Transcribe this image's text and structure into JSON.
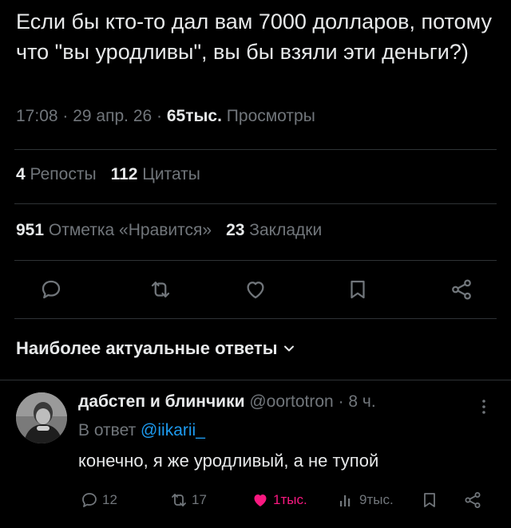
{
  "tweet": {
    "text": "Если бы кто-то дал вам 7000 долларов, потому что \"вы уродливы\", вы бы взяли эти деньги?)",
    "time": "17:08",
    "date": "29 апр. 26",
    "views_count": "65тыс.",
    "views_label": "Просмотры"
  },
  "stats": {
    "reposts_count": "4",
    "reposts_label": "Репосты",
    "quotes_count": "112",
    "quotes_label": "Цитаты",
    "likes_count": "951",
    "likes_label": "Отметка «Нравится»",
    "bookmarks_count": "23",
    "bookmarks_label": "Закладки"
  },
  "actions": {
    "icons": [
      "reply-icon",
      "repost-icon",
      "like-icon",
      "bookmark-icon",
      "share-icon"
    ]
  },
  "replies_sort": {
    "label": "Наиболее актуальные ответы"
  },
  "reply": {
    "author_name": "дабстеп и блинчики",
    "author_handle": "@oortotron",
    "time_ago": "8 ч.",
    "reply_to_prefix": "В ответ",
    "reply_to_handle": "@iikarii_",
    "text": "конечно, я же уродливый, а не тупой",
    "replies": "12",
    "reposts": "17",
    "likes": "1тыс.",
    "views": "9тыс."
  },
  "colors": {
    "background": "#000000",
    "text": "#e7e9ea",
    "secondary": "#71767b",
    "accent": "#1d9bf0",
    "like": "#f91880",
    "divider": "#2f3336"
  }
}
